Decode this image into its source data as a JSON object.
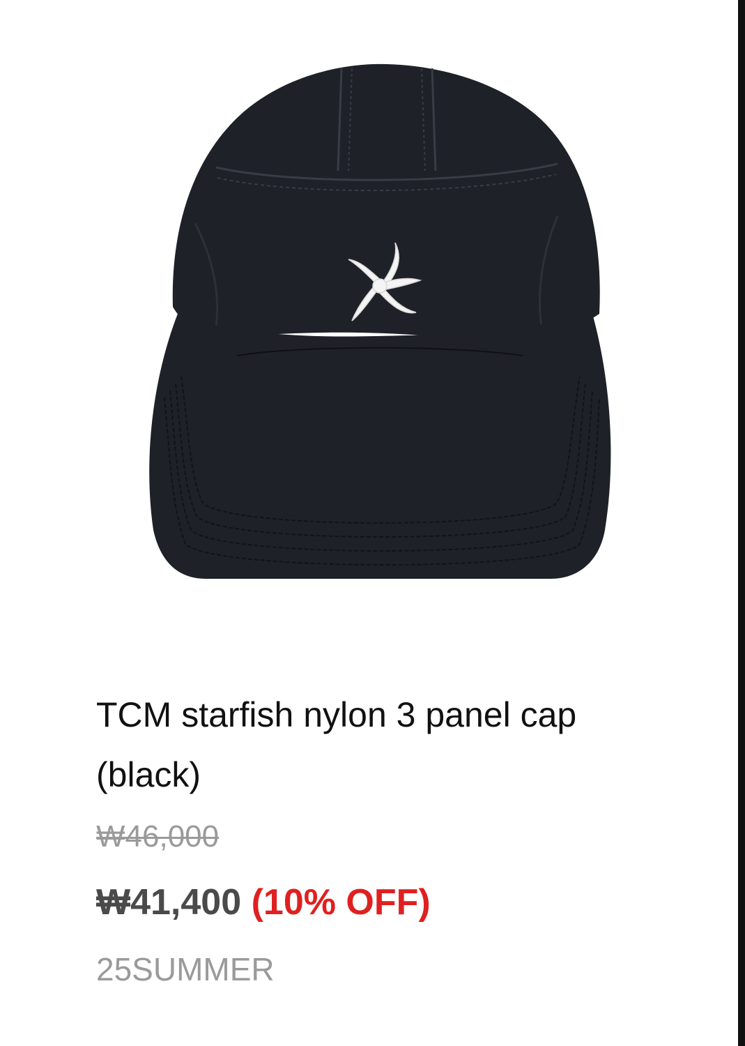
{
  "product": {
    "image_alt": "black nylon 3 panel cap with white starfish embroidery",
    "title": "TCM starfish nylon 3 panel cap (black)",
    "original_price": "₩46,000",
    "sale_price": "₩41,400",
    "discount": " (10% OFF)",
    "season": "25SUMMER"
  },
  "colors": {
    "cap": "#1f2128",
    "embroidery": "#f4f4f4",
    "discount": "#e02020",
    "muted": "#9a9a9a"
  }
}
